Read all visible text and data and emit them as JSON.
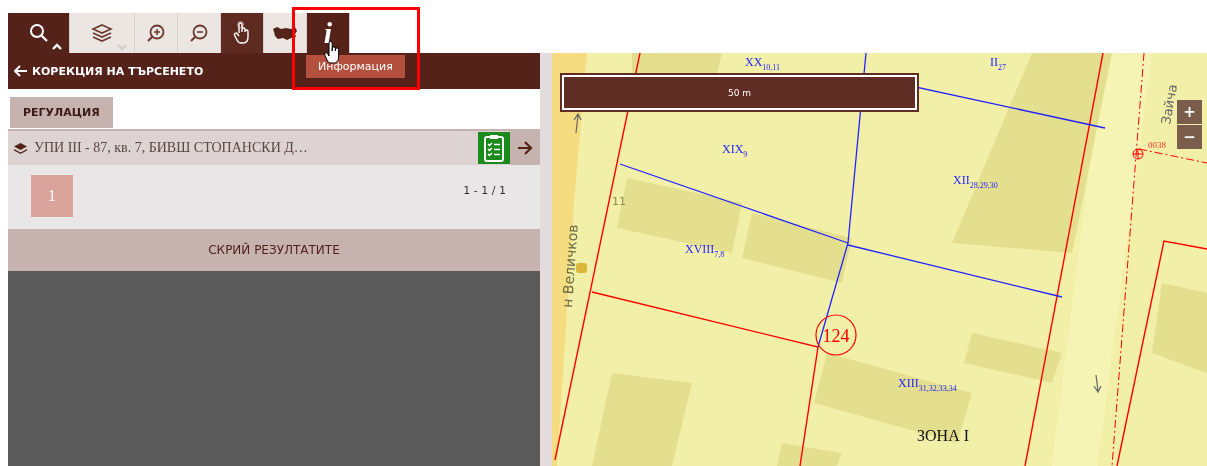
{
  "toolbar": {
    "tools": [
      {
        "kind": "search",
        "selected": true,
        "expanded": true
      },
      {
        "kind": "layers",
        "selected": false,
        "expanded": false
      },
      {
        "kind": "zoom-in",
        "selected": false
      },
      {
        "kind": "zoom-out",
        "selected": false
      },
      {
        "kind": "pan",
        "selected": true
      },
      {
        "kind": "country",
        "selected": false
      },
      {
        "kind": "info",
        "selected": true,
        "glyph": "i"
      }
    ]
  },
  "tooltip": "Информация",
  "back_link": "КОРЕКЦИЯ НА ТЪРСЕНЕТО",
  "tabs": [
    {
      "label": "РЕГУЛАЦИЯ",
      "selected": true
    }
  ],
  "result": {
    "title": "УПИ III - 87, кв. 7, БИВШ СТОПАНСКИ Д…"
  },
  "pager": {
    "pages": [
      {
        "label": "1",
        "selected": true
      }
    ],
    "range": "1 - 1 / 1"
  },
  "hide_button": "СКРИЙ РЕЗУЛТАТИТЕ",
  "map": {
    "scale": "50 m",
    "zoom_in": "+",
    "zoom_out": "−",
    "parcels": [
      {
        "name": "XX",
        "sub": "10,11"
      },
      {
        "name": "II",
        "sub": "27"
      },
      {
        "name": "XIX",
        "sub": "9"
      },
      {
        "name": "XII",
        "sub": "28,29,30"
      },
      {
        "name": "XVIII",
        "sub": "7,8"
      },
      {
        "name": "XIII",
        "sub": "31,32,33,34"
      }
    ],
    "plot_number": "124",
    "zone": "ЗОНА I",
    "point_label": "0038",
    "house_number": "11",
    "streets": [
      "Зайча",
      "н Величков"
    ]
  }
}
